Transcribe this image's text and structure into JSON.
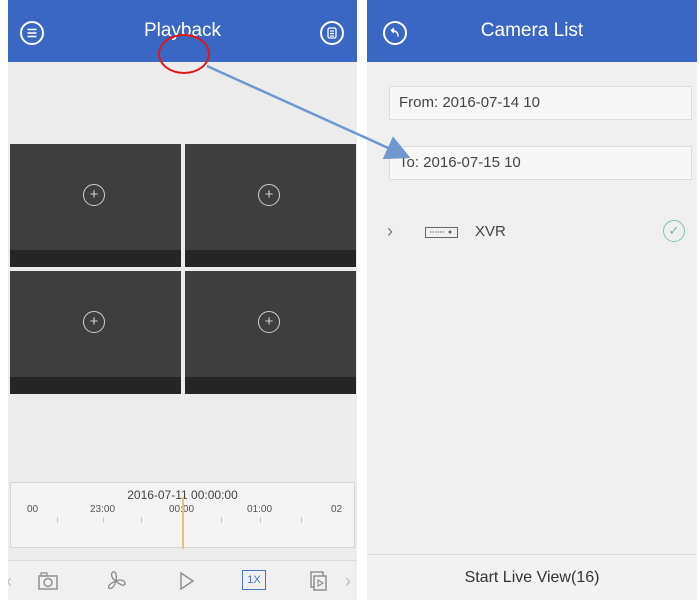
{
  "playback": {
    "title": "Playback",
    "menu_icon": "menu-icon",
    "device_list_icon": "device-list-icon",
    "tiles": [
      {
        "icon": "add-camera-icon"
      },
      {
        "icon": "add-camera-icon"
      },
      {
        "icon": "add-camera-icon"
      },
      {
        "icon": "add-camera-icon"
      }
    ],
    "timeline": {
      "date": "2016-07-11 00:00:00",
      "ticks": [
        "00",
        "23:00",
        "00:00",
        "01:00",
        "02"
      ]
    },
    "toolbar": {
      "snapshot_icon": "camera-icon",
      "fan_icon": "fan-icon",
      "play_icon": "play-icon",
      "speed_label": "1X",
      "export_icon": "export-icon"
    }
  },
  "camera_list": {
    "title": "Camera List",
    "back_icon": "back-icon",
    "from_label": "From: 2016-07-14 10",
    "to_label": "To: 2016-07-15 10",
    "device": {
      "name": "XVR",
      "checked": true
    },
    "start_button": "Start Live View(16)"
  },
  "colors": {
    "header_blue": "#3a67c4",
    "annotation_red": "#e01818",
    "arrow_blue": "#6f98cf"
  }
}
